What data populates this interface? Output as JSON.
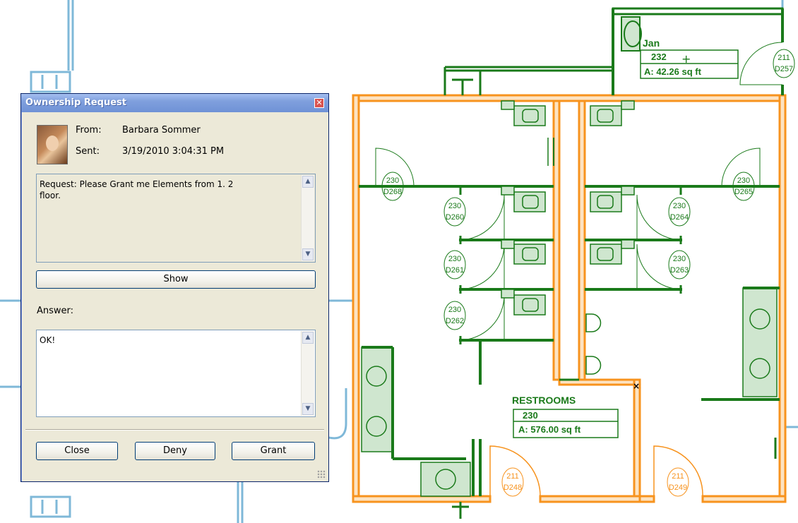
{
  "floorplan": {
    "rooms": [
      {
        "name": "RESTROOMS",
        "number": "230",
        "area": "A: 576.00 sq ft"
      },
      {
        "name": "Jan",
        "number": "232",
        "area": "A: 42.26 sq ft"
      }
    ],
    "door_tags": [
      {
        "room": "230",
        "door": "D268"
      },
      {
        "room": "230",
        "door": "D260"
      },
      {
        "room": "230",
        "door": "D261"
      },
      {
        "room": "230",
        "door": "D262"
      },
      {
        "room": "230",
        "door": "D265"
      },
      {
        "room": "230",
        "door": "D264"
      },
      {
        "room": "230",
        "door": "D263"
      },
      {
        "room": "211",
        "door": "D257"
      },
      {
        "room": "211",
        "door": "D248"
      },
      {
        "room": "211",
        "door": "D249"
      }
    ],
    "colors": {
      "walls_selected": "#f7931e",
      "elements": "#1a7a1a",
      "grid": "#7fb8d8"
    }
  },
  "dialog": {
    "title": "Ownership Request",
    "from_label": "From:",
    "from_value": "Barbara Sommer",
    "sent_label": "Sent:",
    "sent_value": "3/19/2010 3:04:31 PM",
    "request_text_line1": "Request: Please Grant me Elements from 1. 2",
    "request_text_line2": "floor.",
    "show_button": "Show",
    "answer_label": "Answer:",
    "answer_value": "OK!",
    "buttons": {
      "close": "Close",
      "deny": "Deny",
      "grant": "Grant"
    }
  }
}
